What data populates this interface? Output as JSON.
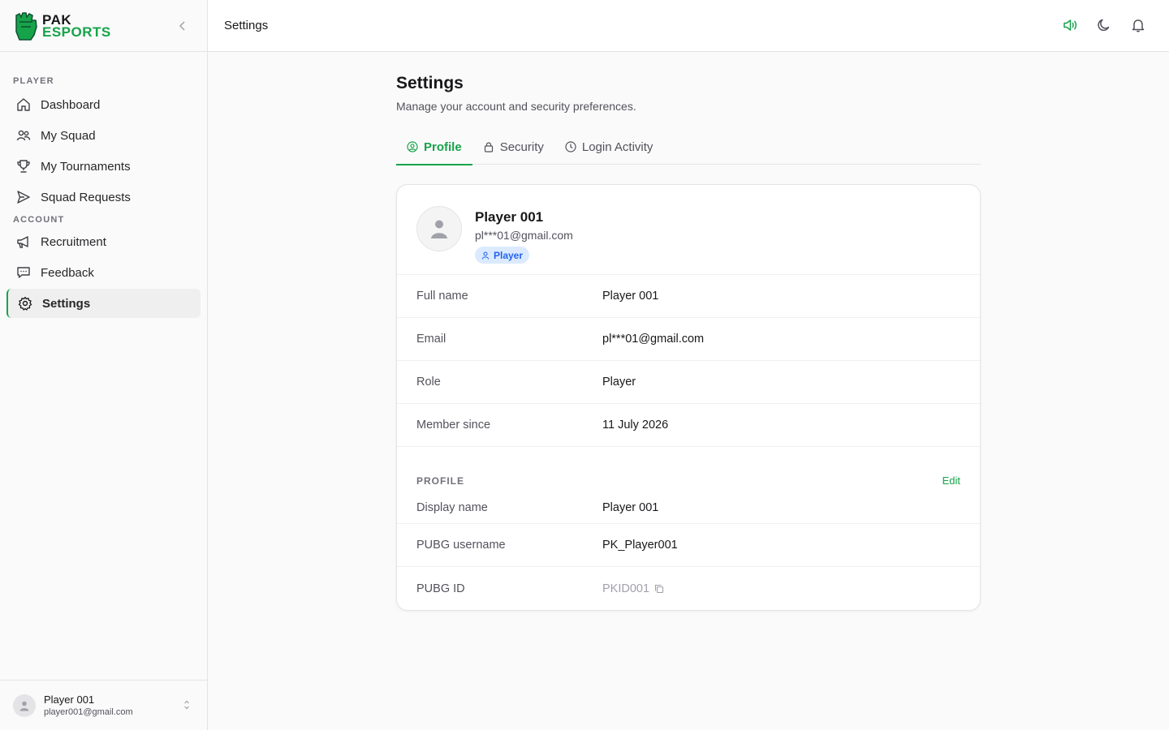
{
  "brand": {
    "line1": "PAK",
    "line2": "ESPORTS",
    "accent": "#16a34a"
  },
  "sidebar": {
    "sections": [
      {
        "label": "PLAYER"
      },
      {
        "label": "ACCOUNT"
      }
    ],
    "items": [
      {
        "label": "Dashboard",
        "icon": "home-icon"
      },
      {
        "label": "My Squad",
        "icon": "users-icon"
      },
      {
        "label": "My Tournaments",
        "icon": "trophy-icon"
      },
      {
        "label": "Squad Requests",
        "icon": "send-icon"
      },
      {
        "label": "Recruitment",
        "icon": "megaphone-icon"
      },
      {
        "label": "Feedback",
        "icon": "message-icon"
      },
      {
        "label": "Settings",
        "icon": "gear-icon",
        "active": true
      }
    ],
    "user": {
      "name": "Player 001",
      "email": "player001@gmail.com"
    }
  },
  "topbar": {
    "title": "Settings",
    "icons": [
      "speaker-icon",
      "moon-icon",
      "bell-icon"
    ]
  },
  "page": {
    "title": "Settings",
    "subtitle": "Manage your account and security preferences."
  },
  "tabs": [
    {
      "label": "Profile",
      "icon": "user-circle-icon",
      "active": true
    },
    {
      "label": "Security",
      "icon": "lock-icon"
    },
    {
      "label": "Login Activity",
      "icon": "clock-icon"
    }
  ],
  "profile": {
    "name": "Player 001",
    "email": "pl***01@gmail.com",
    "badge": "Player"
  },
  "account_rows": [
    {
      "label": "Full name",
      "value": "Player 001"
    },
    {
      "label": "Email",
      "value": "pl***01@gmail.com"
    },
    {
      "label": "Role",
      "value": "Player"
    },
    {
      "label": "Member since",
      "value": "11 July 2026"
    }
  ],
  "profile_section": {
    "label": "PROFILE",
    "edit_label": "Edit",
    "rows": [
      {
        "label": "Display name",
        "value": "Player 001"
      },
      {
        "label": "PUBG username",
        "value": "PK_Player001"
      },
      {
        "label": "PUBG ID",
        "value": "PKID001"
      }
    ]
  }
}
